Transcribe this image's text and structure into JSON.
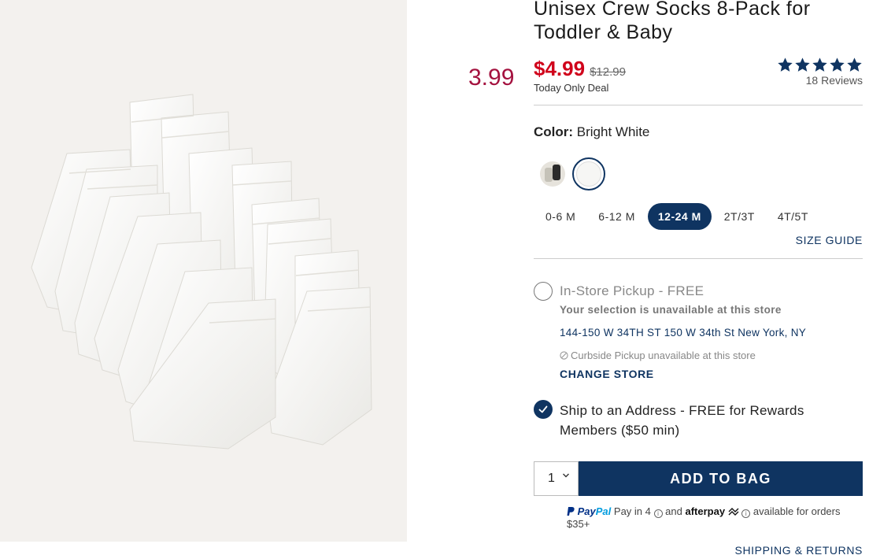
{
  "promo_overlay": "3.99",
  "product": {
    "title": "Unisex Crew Socks 8-Pack for Toddler & Baby",
    "sale_price": "$4.99",
    "original_price": "$12.99",
    "deal_label": "Today Only Deal",
    "rating_stars": 5,
    "reviews": "18 Reviews"
  },
  "color": {
    "label": "Color:",
    "value": "Bright White",
    "swatches": [
      "multi-color-swatch",
      "bright-white-swatch"
    ],
    "selected": "Bright White"
  },
  "sizes": {
    "options": [
      "0-6 M",
      "6-12 M",
      "12-24 M",
      "2T/3T",
      "4T/5T"
    ],
    "selected": "12-24 M",
    "guide_link": "SIZE GUIDE"
  },
  "fulfillment": {
    "pickup_label": "In-Store Pickup - FREE",
    "pickup_status": "Your selection is unavailable at this store",
    "store_address": "144-150 W 34TH ST 150 W 34th St  New York, NY",
    "curbside_note": "Curbside Pickup unavailable at this store",
    "change_store": "CHANGE STORE",
    "ship_label": "Ship to an Address - FREE for Rewards Members ($50 min)"
  },
  "purchase": {
    "quantity": "1",
    "add_to_bag": "ADD TO BAG"
  },
  "payments": {
    "paypal_p1": "Pay",
    "paypal_p2": "Pal",
    "pay_in_4": "Pay in 4",
    "and": "and",
    "afterpay": "afterpay",
    "available": "available for orders $35+"
  },
  "shipping_returns": "SHIPPING & RETURNS",
  "colors": {
    "navy": "#0f3461",
    "sale_red": "#d0021b",
    "promo_red": "#a4123f"
  }
}
